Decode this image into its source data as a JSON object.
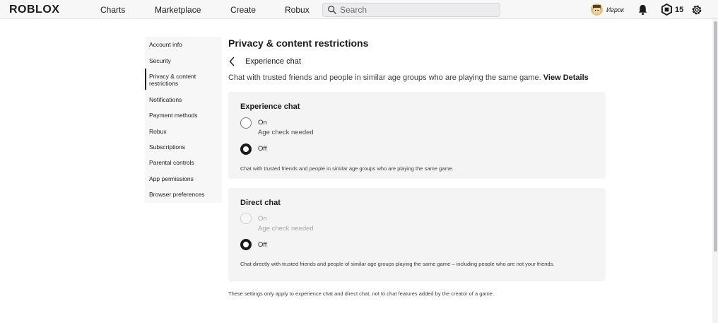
{
  "header": {
    "logo": "ROBLOX",
    "nav": [
      "Charts",
      "Marketplace",
      "Create",
      "Robux"
    ],
    "search_placeholder": "Search",
    "username": "Игрок",
    "robux_count": "15"
  },
  "sidebar": {
    "items": [
      "Account info",
      "Security",
      "Privacy & content restrictions",
      "Notifications",
      "Payment methods",
      "Robux",
      "Subscriptions",
      "Parental controls",
      "App permissions",
      "Browser preferences"
    ],
    "active_index": 2
  },
  "main": {
    "title": "Privacy & content restrictions",
    "subtitle": "Experience chat",
    "description": "Chat with trusted friends and people in similar age groups who are playing the same game.",
    "view_details": "View Details",
    "experience_card": {
      "title": "Experience chat",
      "on_label": "On",
      "on_sub": "Age check needed",
      "off_label": "Off",
      "selected": "Off",
      "note": "Chat with trusted friends and people in similar age groups who are playing the same game."
    },
    "direct_card": {
      "title": "Direct chat",
      "on_label": "On",
      "on_sub": "Age check needed",
      "off_label": "Off",
      "selected": "Off",
      "note": "Chat directly with trusted friends and people of similar age groups playing the same game – including people who are not your friends."
    },
    "footer_note": "These settings only apply to experience chat and direct chat, not to chat features added by the creator of a game."
  },
  "colors": {
    "text": "#1b1b1d",
    "card_bg": "#f4f4f5",
    "nav_bg": "#f7f7f8"
  }
}
